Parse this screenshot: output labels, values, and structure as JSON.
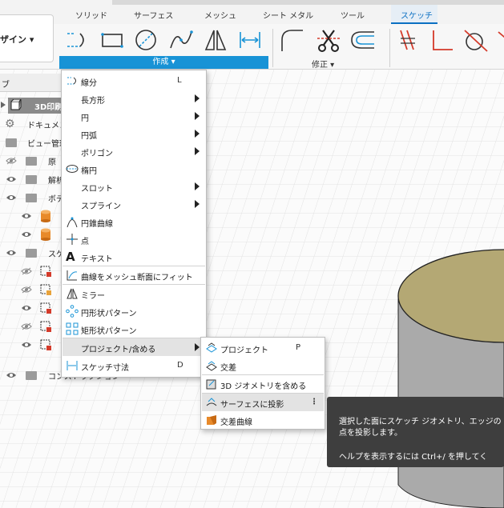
{
  "tabs": [
    "ソリッド",
    "サーフェス",
    "メッシュ",
    "シート メタル",
    "ツール",
    "スケッチ"
  ],
  "active_tab": "スケッチ",
  "design_button_label": "ザイン ▾",
  "ribbon": {
    "create_label": "作成 ▾",
    "modify_label": "修正 ▾"
  },
  "browser": {
    "header_label": "ブ",
    "items": [
      {
        "label": "3D印刷",
        "kind": "root"
      },
      {
        "label": "ドキュメン",
        "kind": "settings"
      },
      {
        "label": "ビュー管理",
        "kind": "folder"
      },
      {
        "label": "原",
        "kind": "folder"
      },
      {
        "label": "解析",
        "kind": "folder"
      },
      {
        "label": "ボデ",
        "kind": "folder"
      },
      {
        "label": "",
        "kind": "body"
      },
      {
        "label": "",
        "kind": "body"
      },
      {
        "label": "スケ",
        "kind": "folder"
      },
      {
        "label": "",
        "kind": "sketch"
      },
      {
        "label": "",
        "kind": "sketch"
      },
      {
        "label": "",
        "kind": "sketch"
      },
      {
        "label": "",
        "kind": "sketch"
      },
      {
        "label": "",
        "kind": "sketch"
      },
      {
        "label": "コンストラクション",
        "kind": "folder"
      }
    ]
  },
  "create_menu": {
    "items": [
      {
        "label": "線分",
        "shortcut": "L",
        "submenu": false,
        "icon": "line-icon"
      },
      {
        "label": "長方形",
        "shortcut": "",
        "submenu": true,
        "icon": ""
      },
      {
        "label": "円",
        "shortcut": "",
        "submenu": true,
        "icon": ""
      },
      {
        "label": "円弧",
        "shortcut": "",
        "submenu": true,
        "icon": ""
      },
      {
        "label": "ポリゴン",
        "shortcut": "",
        "submenu": true,
        "icon": ""
      },
      {
        "label": "楕円",
        "shortcut": "",
        "submenu": false,
        "icon": "ellipse-icon"
      },
      {
        "label": "スロット",
        "shortcut": "",
        "submenu": true,
        "icon": ""
      },
      {
        "label": "スプライン",
        "shortcut": "",
        "submenu": true,
        "icon": ""
      },
      {
        "label": "円錐曲線",
        "shortcut": "",
        "submenu": false,
        "icon": "conic-icon"
      },
      {
        "label": "点",
        "shortcut": "",
        "submenu": false,
        "icon": "point-icon"
      },
      {
        "label": "テキスト",
        "shortcut": "",
        "submenu": false,
        "icon": "text-icon"
      },
      {
        "label": "曲線をメッシュ断面にフィット",
        "shortcut": "",
        "submenu": false,
        "icon": "fit-curve-icon"
      },
      {
        "label": "ミラー",
        "shortcut": "",
        "submenu": false,
        "icon": "mirror-icon"
      },
      {
        "label": "円形状パターン",
        "shortcut": "",
        "submenu": false,
        "icon": "circular-pattern-icon"
      },
      {
        "label": "矩形状パターン",
        "shortcut": "",
        "submenu": false,
        "icon": "rectangular-pattern-icon"
      },
      {
        "label": "プロジェクト/含める",
        "shortcut": "",
        "submenu": true,
        "icon": ""
      },
      {
        "label": "スケッチ寸法",
        "shortcut": "D",
        "submenu": false,
        "icon": "dimension-icon"
      }
    ]
  },
  "project_submenu": {
    "items": [
      {
        "label": "プロジェクト",
        "shortcut": "P",
        "icon": "project-icon"
      },
      {
        "label": "交差",
        "shortcut": "",
        "icon": "intersect-icon"
      },
      {
        "label": "3D ジオメトリを含める",
        "shortcut": "",
        "icon": "include-3d-icon"
      },
      {
        "label": "サーフェスに投影",
        "shortcut": "⋮",
        "icon": "project-to-surface-icon"
      },
      {
        "label": "交差曲線",
        "shortcut": "",
        "icon": "intersection-curve-icon"
      }
    ]
  },
  "tooltip": {
    "line1": "選択した面にスケッチ ジオメトリ、エッジの",
    "line2": "点を投影します。",
    "line3": "ヘルプを表示するには  Ctrl+/  を押してく"
  },
  "colors": {
    "accent": "#1893d6",
    "tab_active": "#0a6fc2",
    "cylinder_top": "#b4a874",
    "cylinder_side": "#aaaaaa",
    "constraint_red": "#d43a2a"
  }
}
